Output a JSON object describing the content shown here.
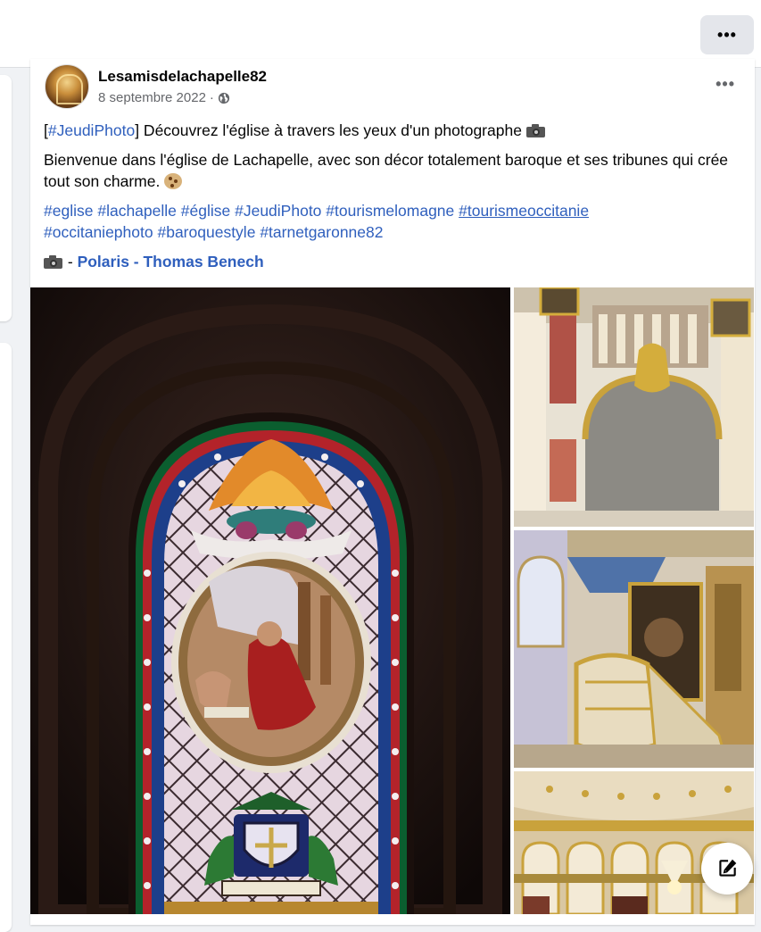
{
  "topbar": {
    "more_label": "•••",
    "more_icon": "more-horizontal-icon"
  },
  "post": {
    "author": "Lesamisdelachapelle82",
    "date": "8 septembre 2022",
    "separator": "·",
    "privacy_icon": "globe-icon",
    "more_label": "•••",
    "line1": {
      "bracket_open": "[",
      "hashtag": "#JeudiPhoto",
      "bracket_close": "]",
      "text": "  Découvrez l'église à travers les yeux d'un photographe"
    },
    "line2": "Bienvenue dans l'église de Lachapelle, avec son décor totalement baroque et ses tribunes qui crée tout son charme.",
    "hashtags": [
      "#eglise",
      "#lachapelle",
      "#église",
      "#JeudiPhoto",
      "#tourismelomagne",
      "#tourismeoccitanie",
      "#occitaniephoto",
      "#baroquestyle",
      "#tarnetgaronne82"
    ],
    "credit": {
      "dash": " - ",
      "link": "Polaris - Thomas Benech"
    }
  },
  "photos": [
    {
      "subject": "stained-glass-window"
    },
    {
      "subject": "baroque-gallery-arch"
    },
    {
      "subject": "baroque-pulpit"
    },
    {
      "subject": "church-interior-tribunes"
    }
  ],
  "floating": {
    "edit_icon": "compose-icon"
  },
  "colors": {
    "link": "#2f5fbd",
    "secondary_text": "#65676b",
    "page_bg": "#f0f2f5"
  }
}
